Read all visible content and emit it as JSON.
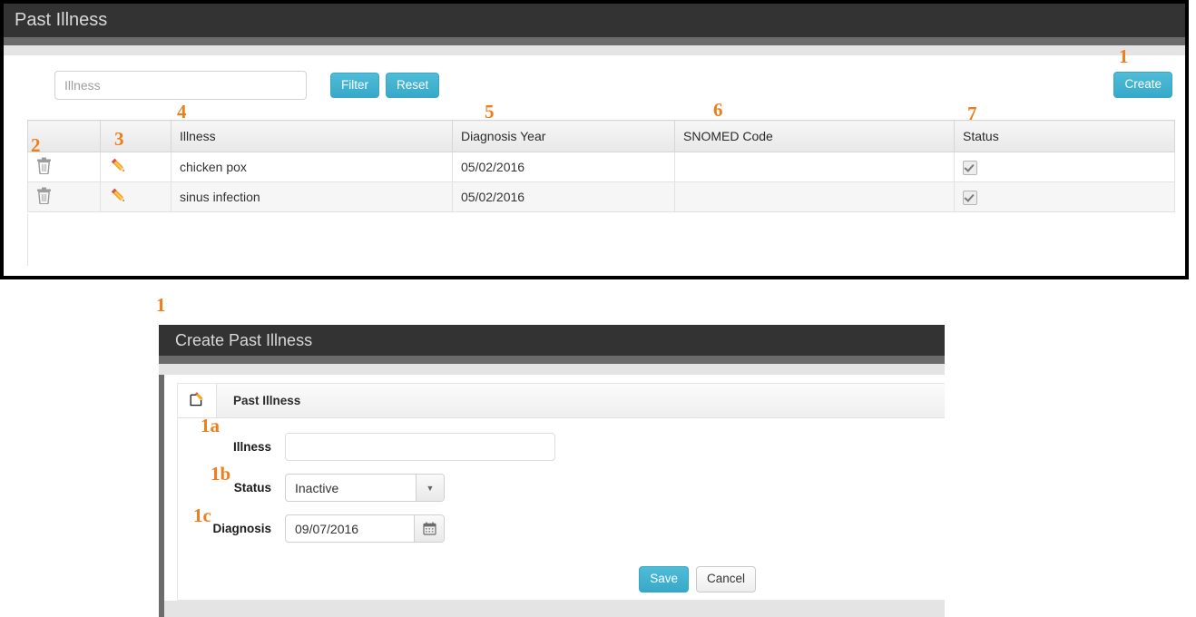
{
  "list_panel": {
    "title": "Past Illness",
    "filter": {
      "placeholder": "Illness",
      "value": "",
      "filter_label": "Filter",
      "reset_label": "Reset"
    },
    "create_label": "Create",
    "table": {
      "columns": [
        "",
        "",
        "Illness",
        "Diagnosis Year",
        "SNOMED Code",
        "Status"
      ],
      "rows": [
        {
          "delete_icon": "trash-icon",
          "edit_icon": "pencil-icon",
          "illness": "chicken pox",
          "diagnosis_year": "05/02/2016",
          "snomed_code": "",
          "status_checked": true
        },
        {
          "delete_icon": "trash-icon",
          "edit_icon": "pencil-icon",
          "illness": "sinus infection",
          "diagnosis_year": "05/02/2016",
          "snomed_code": "",
          "status_checked": true
        }
      ]
    }
  },
  "modal": {
    "title": "Create Past Illness",
    "tab": {
      "icon": "edit-square-icon",
      "label": "Past Illness"
    },
    "fields": {
      "illness_label": "Illness",
      "illness_value": "",
      "status_label": "Status",
      "status_value": "Inactive",
      "diagnosis_label": "Diagnosis",
      "diagnosis_value": "09/07/2016"
    },
    "save_label": "Save",
    "cancel_label": "Cancel"
  },
  "annotations": {
    "a1_top": "1",
    "a2": "2",
    "a3": "3",
    "a4": "4",
    "a5": "5",
    "a6": "6",
    "a7": "7",
    "a1_modal": "1",
    "a1a": "1a",
    "a1b": "1b",
    "a1c": "1c"
  },
  "colors": {
    "accent_blue": "#41b2d0",
    "annotation_orange": "#ee7d1a",
    "header_dark": "#333333"
  }
}
